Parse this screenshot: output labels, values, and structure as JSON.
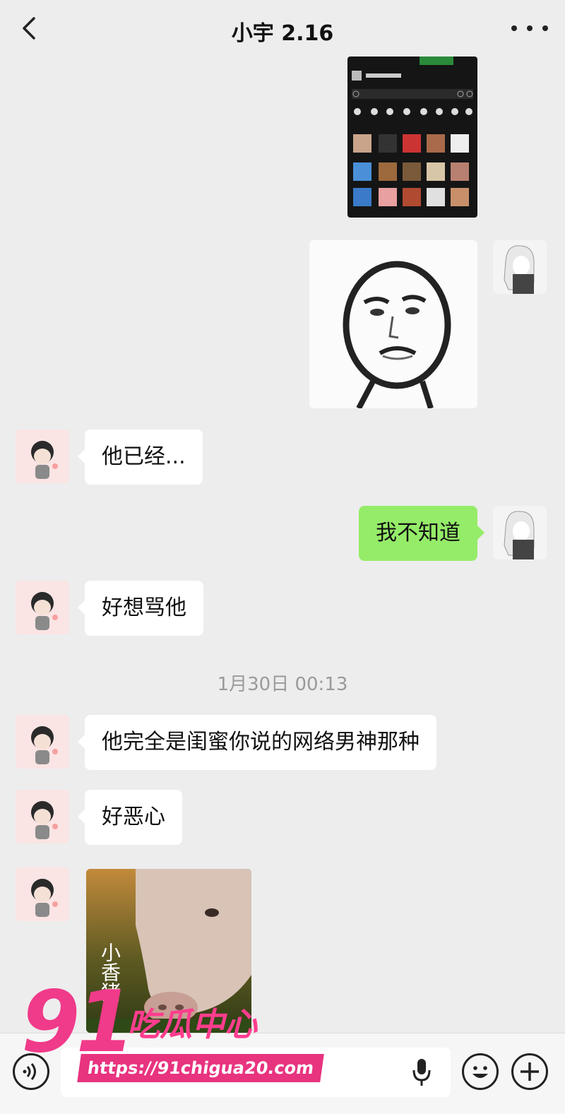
{
  "header": {
    "title": "小宇 2.16"
  },
  "messages": [
    {
      "side": "self",
      "kind": "image",
      "description": "screenshot-of-sticker-panel"
    },
    {
      "side": "self",
      "kind": "sticker",
      "description": "meme-face-sticker"
    },
    {
      "side": "other",
      "kind": "text",
      "text": "他已经..."
    },
    {
      "side": "self",
      "kind": "text",
      "text": "我不知道"
    },
    {
      "side": "other",
      "kind": "text",
      "text": "好想骂他"
    },
    {
      "side": "other",
      "kind": "text",
      "text": "他完全是闺蜜你说的网络男神那种"
    },
    {
      "side": "other",
      "kind": "text",
      "text": "好恶心"
    },
    {
      "side": "other",
      "kind": "image",
      "description": "pig-photo-with-caption"
    }
  ],
  "timestamp": "1月30日 00:13",
  "pig_caption": "小香猪",
  "watermark": {
    "number": "91",
    "name": "吃瓜中心",
    "url": "https://91chigua20.com"
  },
  "colors": {
    "background": "#ededed",
    "self_bubble": "#95ec69",
    "other_bubble": "#ffffff",
    "watermark_pink": "#f03a8a"
  }
}
